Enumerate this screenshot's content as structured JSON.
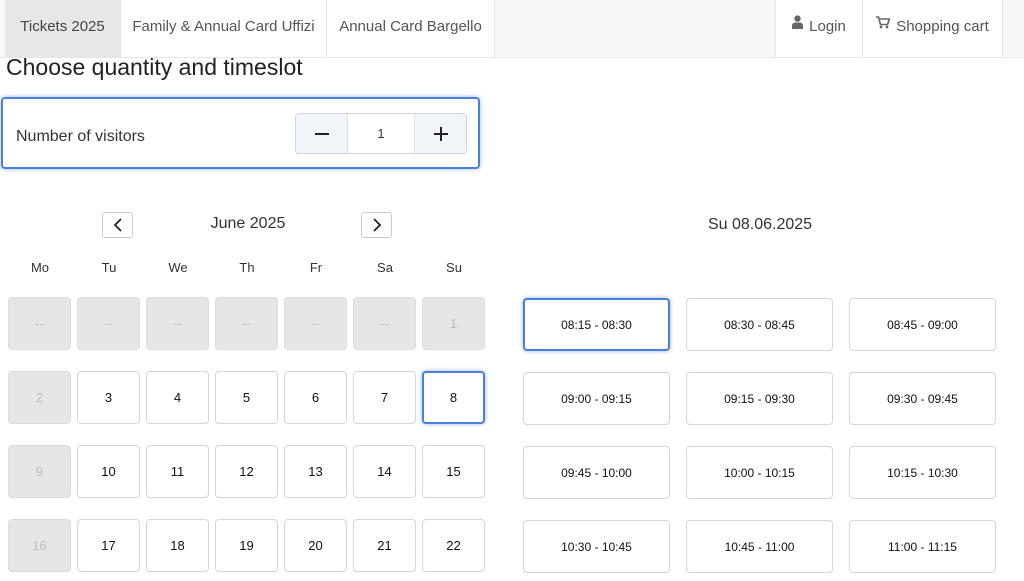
{
  "nav": {
    "tabs": [
      {
        "label": "Tickets 2025"
      },
      {
        "label": "Family & Annual Card Uffizi"
      },
      {
        "label": "Annual Card Bargello"
      }
    ],
    "login_label": "Login",
    "login_icon": "user-icon",
    "cart_label": "Shopping cart",
    "cart_icon": "cart-icon"
  },
  "page_title": "Choose quantity and timeslot",
  "visitors": {
    "label": "Number of visitors",
    "value": "1",
    "minus_icon": "minus-icon",
    "plus_icon": "plus-icon"
  },
  "calendar": {
    "month_title": "June 2025",
    "prev_icon": "chevron-left-icon",
    "next_icon": "chevron-right-icon",
    "weekdays": [
      "Mo",
      "Tu",
      "We",
      "Th",
      "Fr",
      "Sa",
      "Su"
    ],
    "rows": [
      [
        "--",
        "--",
        "--",
        "--",
        "--",
        "--",
        "1"
      ],
      [
        "2",
        "3",
        "4",
        "5",
        "6",
        "7",
        "8"
      ],
      [
        "9",
        "10",
        "11",
        "12",
        "13",
        "14",
        "15"
      ],
      [
        "16",
        "17",
        "18",
        "19",
        "20",
        "21",
        "22"
      ]
    ],
    "disabled_days": [
      "--",
      "1",
      "2",
      "9",
      "16"
    ],
    "selected_day": "8"
  },
  "timeslots": {
    "date_title": "Su 08.06.2025",
    "slots": [
      "08:15 - 08:30",
      "08:30 - 08:45",
      "08:45 - 09:00",
      "09:00 - 09:15",
      "09:15 - 09:30",
      "09:30 - 09:45",
      "09:45 - 10:00",
      "10:00 - 10:15",
      "10:15 - 10:30",
      "10:30 - 10:45",
      "10:45 - 11:00",
      "11:00 - 11:15"
    ],
    "selected": "08:15 - 08:30"
  },
  "colors": {
    "accent": "#4a7fdc",
    "disabled_bg": "#e6e6e6",
    "nav_bg": "#f8f8f8"
  }
}
